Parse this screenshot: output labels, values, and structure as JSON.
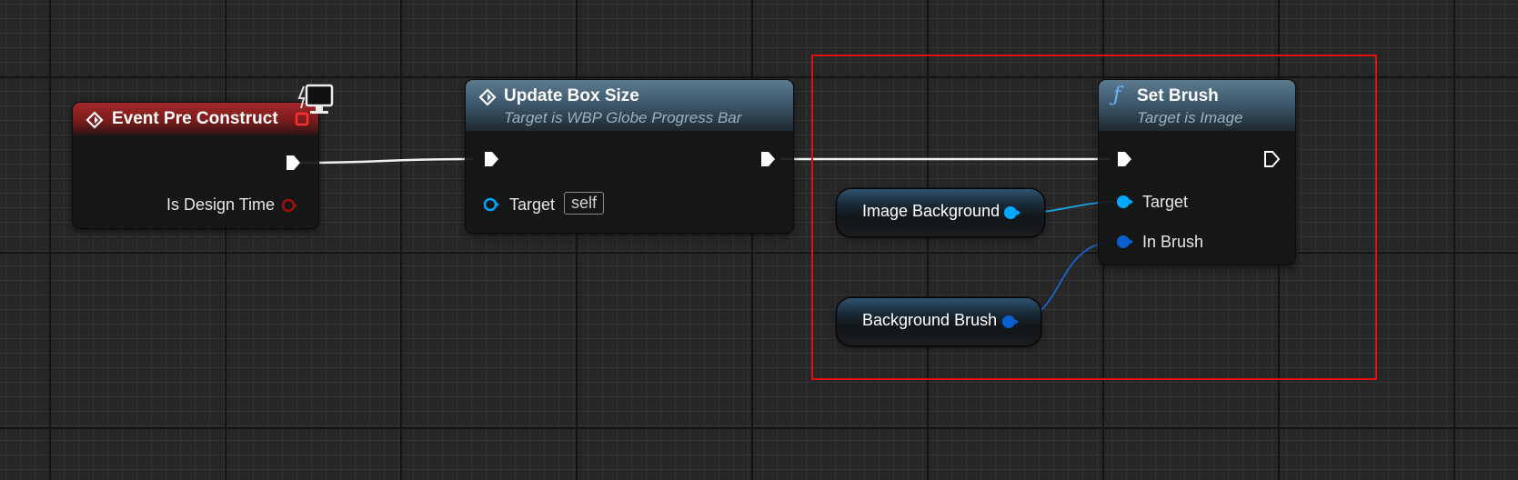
{
  "nodes": {
    "event_pre_construct": {
      "title": "Event Pre Construct",
      "pin_is_design_time": "Is Design Time"
    },
    "update_box_size": {
      "title": "Update Box Size",
      "subtitle": "Target is WBP Globe Progress Bar",
      "pin_target": "Target",
      "target_default": "self"
    },
    "set_brush": {
      "title": "Set Brush",
      "subtitle": "Target is Image",
      "pin_target": "Target",
      "pin_in_brush": "In Brush"
    },
    "image_background": {
      "label": "Image Background"
    },
    "background_brush": {
      "label": "Background Brush"
    }
  },
  "icons": {
    "event": "event-diamond-icon",
    "function": "function-f-icon",
    "client": "client-monitor-icon"
  },
  "colors": {
    "event_header": "#a32828",
    "function_header": "#3f5a6e",
    "exec_wire": "#ffffff",
    "object_pin": "#00a8ff",
    "struct_pin": "#0a5fd1",
    "bool_pin": "#8b0000",
    "selection": "#e01010"
  }
}
